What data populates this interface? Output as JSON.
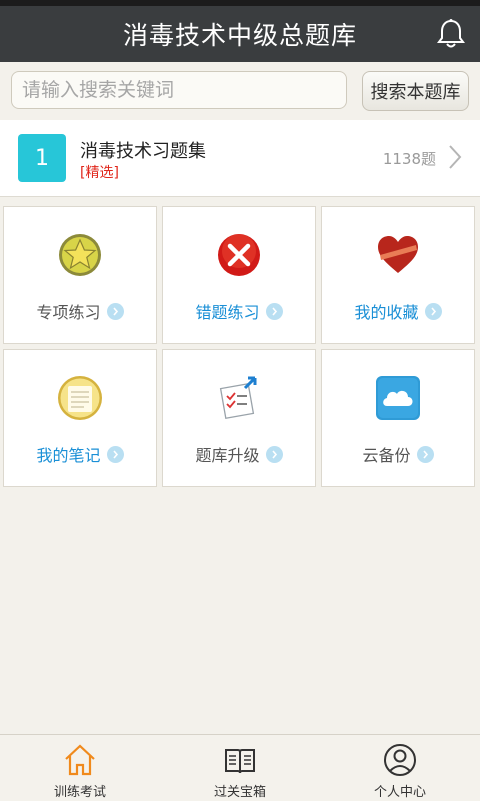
{
  "header": {
    "title": "消毒技术中级总题库",
    "bell_icon": "bell-icon"
  },
  "search": {
    "placeholder": "请输入搜索关键词",
    "value": "",
    "button_label": "搜索本题库"
  },
  "collection": {
    "number": "1",
    "title": "消毒技术习题集",
    "tag": "[精选]",
    "count": "1138题",
    "accent": "#27c6d8"
  },
  "tiles": [
    {
      "label": "专项练习",
      "icon": "star-badge-icon",
      "color": "#555555"
    },
    {
      "label": "错题练习",
      "icon": "red-x-icon",
      "color": "#1a8fd6"
    },
    {
      "label": "我的收藏",
      "icon": "heart-icon",
      "color": "#1a8fd6"
    },
    {
      "label": "我的笔记",
      "icon": "notepad-icon",
      "color": "#1a8fd6"
    },
    {
      "label": "题库升级",
      "icon": "upgrade-checklist-icon",
      "color": "#555555"
    },
    {
      "label": "云备份",
      "icon": "cloud-icon",
      "color": "#555555"
    }
  ],
  "tabbar": [
    {
      "label": "训练考试",
      "icon": "home-icon",
      "active": true,
      "active_color": "#f08a1c"
    },
    {
      "label": "过关宝箱",
      "icon": "book-icon",
      "active": false
    },
    {
      "label": "个人中心",
      "icon": "user-icon",
      "active": false
    }
  ]
}
